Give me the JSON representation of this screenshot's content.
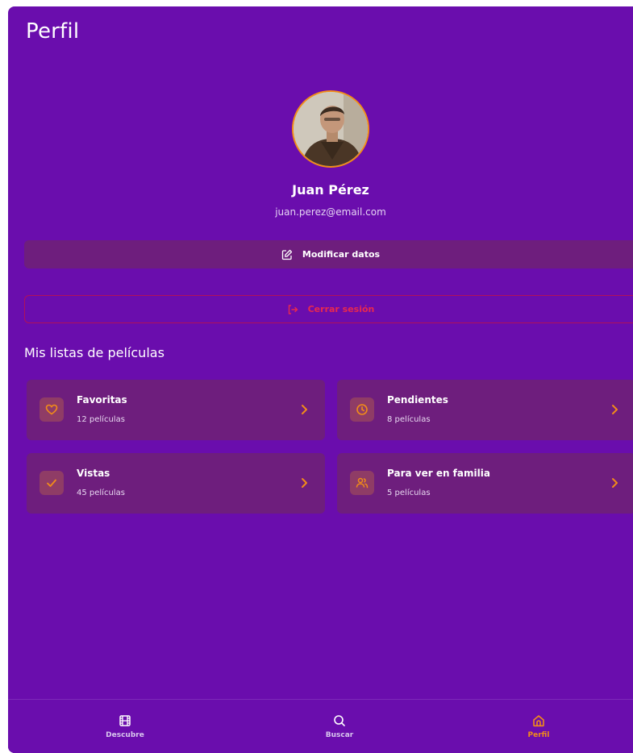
{
  "header": {
    "title": "Perfil"
  },
  "profile": {
    "name": "Juan Pérez",
    "email": "juan.perez@email.com"
  },
  "actions": {
    "edit_label": "Modificar datos",
    "logout_label": "Cerrar sesión"
  },
  "lists": {
    "title": "Mis listas de películas",
    "items": [
      {
        "title": "Favoritas",
        "count": "12 películas",
        "icon": "heart-icon"
      },
      {
        "title": "Pendientes",
        "count": "8 películas",
        "icon": "clock-icon"
      },
      {
        "title": "Vistas",
        "count": "45 películas",
        "icon": "check-icon"
      },
      {
        "title": "Para ver en familia",
        "count": "5 películas",
        "icon": "users-icon"
      }
    ]
  },
  "nav": {
    "items": [
      {
        "label": "Descubre",
        "icon": "film-icon"
      },
      {
        "label": "Buscar",
        "icon": "search-icon"
      },
      {
        "label": "Perfil",
        "icon": "home-icon",
        "active": true
      }
    ]
  },
  "colors": {
    "background": "#6a0dad",
    "card": "#6e1e7d",
    "accent": "#f28c18",
    "danger": "#e8294f"
  }
}
